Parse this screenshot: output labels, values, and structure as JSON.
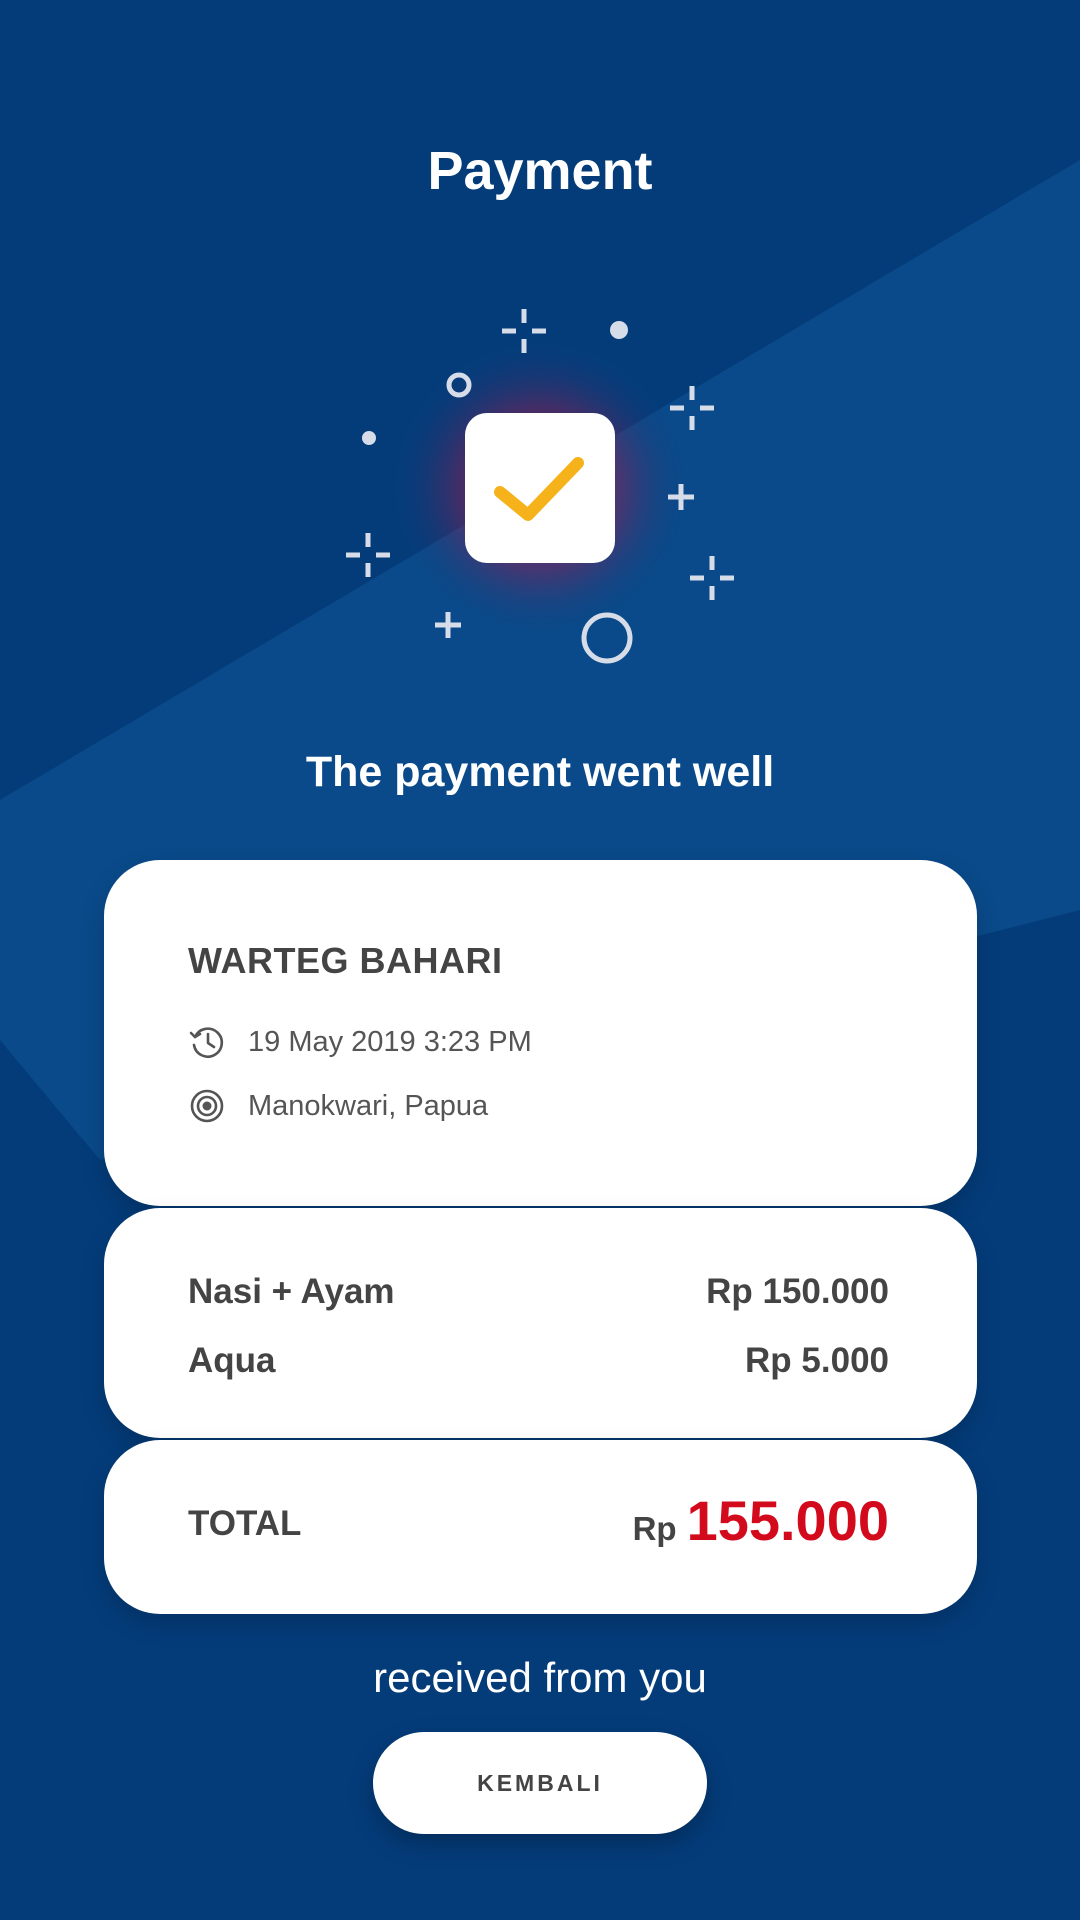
{
  "header": {
    "title": "Payment"
  },
  "status": {
    "message": "The payment went well"
  },
  "merchant": {
    "name": "WARTEG BAHARI",
    "datetime": "19 May 2019 3:23 PM",
    "location": "Manokwari, Papua",
    "datetime_icon": "history-icon",
    "location_icon": "location-target-icon"
  },
  "items": [
    {
      "name": "Nasi + Ayam",
      "price": "Rp 150.000"
    },
    {
      "name": "Aqua",
      "price": "Rp 5.000"
    }
  ],
  "total": {
    "label": "TOTAL",
    "currency": "Rp",
    "amount": "155.000"
  },
  "footer": {
    "message": "received from you",
    "button_label": "KEMBALI"
  },
  "colors": {
    "background": "#043c7a",
    "total_amount": "#d3091c",
    "checkmark": "#f6b21a"
  }
}
